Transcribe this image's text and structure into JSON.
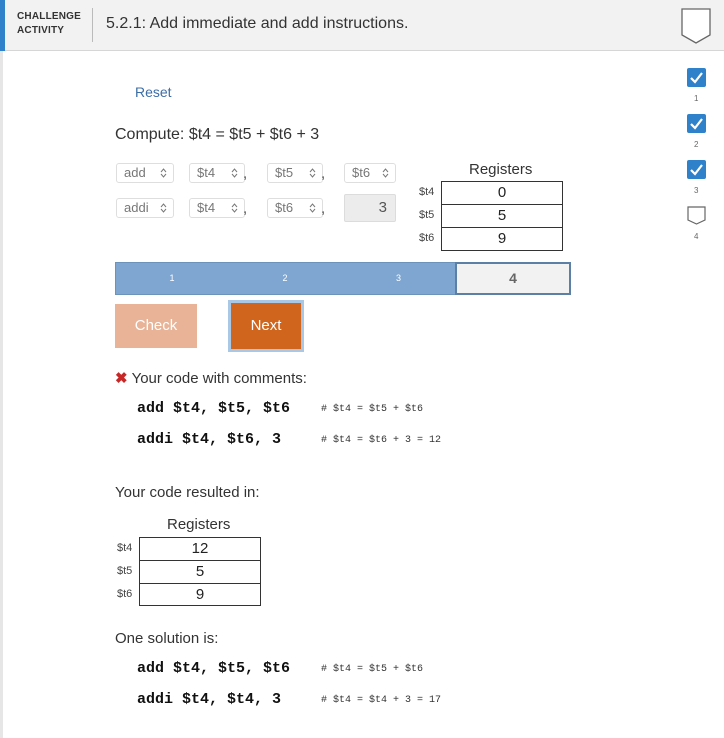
{
  "header": {
    "tag_line1": "CHALLENGE",
    "tag_line2": "ACTIVITY",
    "title": "5.2.1: Add immediate and add instructions.",
    "badge_icon": "badge-outline-icon"
  },
  "reset_label": "Reset",
  "prompt": "Compute: $t4 = $t5 + $t6 + 3",
  "rows": [
    {
      "op": "add",
      "dst": "$t4",
      "src": "$t5",
      "third": "$t6"
    },
    {
      "op": "addi",
      "dst": "$t4",
      "src": "$t6",
      "third": "3"
    }
  ],
  "registers_initial": {
    "title": "Registers",
    "items": [
      {
        "name": "$t4",
        "value": "0"
      },
      {
        "name": "$t5",
        "value": "5"
      },
      {
        "name": "$t6",
        "value": "9"
      }
    ]
  },
  "progress": {
    "steps": [
      "1",
      "2",
      "3",
      "4"
    ],
    "current": "4",
    "color": "#7ea6d0"
  },
  "buttons": {
    "check": "Check",
    "next": "Next"
  },
  "feedback": {
    "icon": "x-mark-icon",
    "title": "Your code with comments:",
    "lines": [
      {
        "code": "add $t4, $t5, $t6",
        "comment": "# $t4 = $t5 + $t6"
      },
      {
        "code": "addi $t4, $t6, 3",
        "comment": "# $t4 = $t6 + 3 = 12"
      }
    ]
  },
  "result_label": "Your code resulted in:",
  "registers_result": {
    "title": "Registers",
    "items": [
      {
        "name": "$t4",
        "value": "12"
      },
      {
        "name": "$t5",
        "value": "5"
      },
      {
        "name": "$t6",
        "value": "9"
      }
    ]
  },
  "solution_label": "One solution is:",
  "solution": [
    {
      "code": "add $t4, $t5, $t6",
      "comment": "# $t4 = $t5 + $t6"
    },
    {
      "code": "addi $t4, $t4, 3",
      "comment": "# $t4 = $t4 + 3 = 17"
    }
  ],
  "completion": [
    {
      "num": "1",
      "done": true
    },
    {
      "num": "2",
      "done": true
    },
    {
      "num": "3",
      "done": true
    },
    {
      "num": "4",
      "done": false
    }
  ],
  "colors": {
    "accent": "#2f82c9",
    "check_done": "#2f82c9",
    "next": "#d0661e",
    "error": "#c62828"
  }
}
